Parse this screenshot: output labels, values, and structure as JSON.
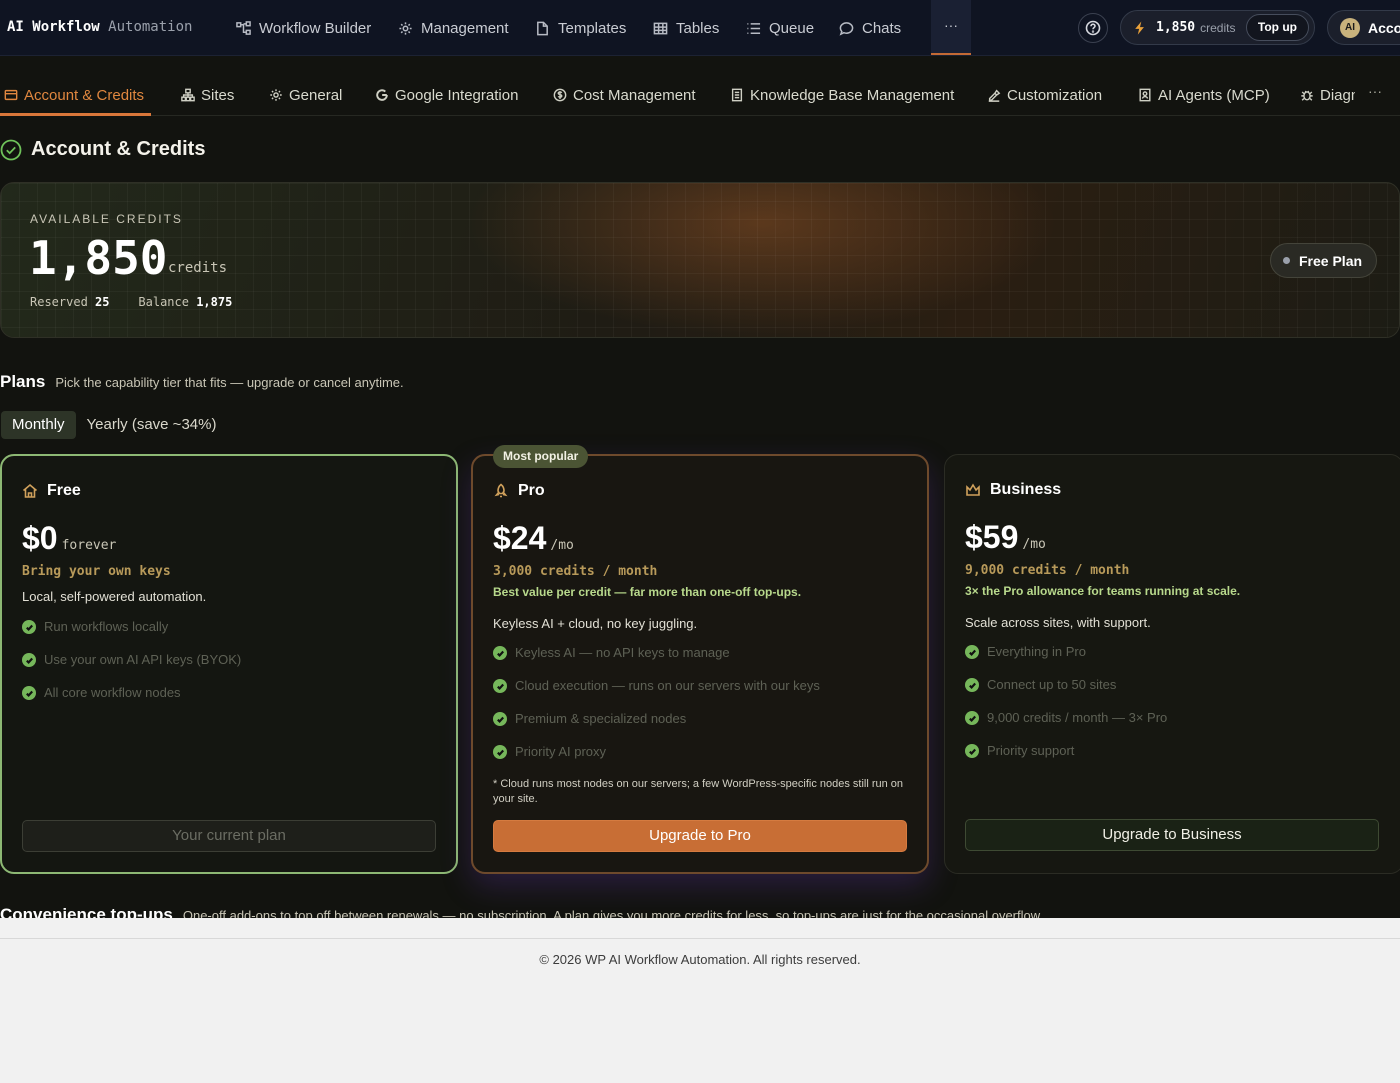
{
  "brand": {
    "bold": "AI Workflow",
    "light": "Automation"
  },
  "nav": {
    "items": [
      {
        "label": "Workflow Builder",
        "icon": "workflow-icon"
      },
      {
        "label": "Management",
        "icon": "gear-icon"
      },
      {
        "label": "Templates",
        "icon": "file-icon"
      },
      {
        "label": "Tables",
        "icon": "table-icon"
      },
      {
        "label": "Queue",
        "icon": "list-icon"
      },
      {
        "label": "Chats",
        "icon": "chat-icon"
      }
    ],
    "more_label": "···",
    "credits": {
      "value": "1,850",
      "label": "credits"
    },
    "topup_label": "Top up",
    "account": {
      "avatar": "AI",
      "label": "Account"
    }
  },
  "subnav": {
    "items": [
      {
        "label": "Account & Credits",
        "icon": "card-icon",
        "active": true
      },
      {
        "label": "Sites",
        "icon": "sitemap-icon"
      },
      {
        "label": "General",
        "icon": "gear-icon"
      },
      {
        "label": "Google Integration",
        "icon": "google-icon"
      },
      {
        "label": "Cost Management",
        "icon": "dollar-icon"
      },
      {
        "label": "Knowledge Base Management",
        "icon": "book-icon"
      },
      {
        "label": "Customization",
        "icon": "brush-icon"
      },
      {
        "label": "AI Agents (MCP)",
        "icon": "agent-icon"
      },
      {
        "label": "Diagnostics",
        "icon": "bug-icon"
      }
    ],
    "more_label": "···"
  },
  "section": {
    "title": "Account & Credits"
  },
  "credits_card": {
    "label": "AVAILABLE CREDITS",
    "value": "1,850",
    "unit": "credits",
    "reserved_label": "Reserved",
    "reserved_value": "25",
    "balance_label": "Balance",
    "balance_value": "1,875",
    "plan_badge": "Free Plan"
  },
  "plans": {
    "title": "Plans",
    "subtitle": "Pick the capability tier that fits — upgrade or cancel anytime.",
    "toggle": {
      "monthly": "Monthly",
      "yearly": "Yearly (save ~34%)"
    },
    "popular_badge": "Most popular",
    "free": {
      "name": "Free",
      "price": "$0",
      "unit": "forever",
      "credits": "Bring your own keys",
      "desc": "Local, self-powered automation.",
      "features": [
        "Run workflows locally",
        "Use your own AI API keys (BYOK)",
        "All core workflow nodes"
      ],
      "button": "Your current plan"
    },
    "pro": {
      "name": "Pro",
      "price": "$24",
      "unit": "/mo",
      "credits": "3,000 credits / month",
      "note": "Best value per credit — far more than one-off top-ups.",
      "desc": "Keyless AI + cloud, no key juggling.",
      "features": [
        "Keyless AI — no API keys to manage",
        "Cloud execution — runs on our servers with our keys",
        "Premium & specialized nodes",
        "Priority AI proxy"
      ],
      "footnote": "* Cloud runs most nodes on our servers; a few WordPress-specific nodes still run on your site.",
      "button": "Upgrade to Pro"
    },
    "business": {
      "name": "Business",
      "price": "$59",
      "unit": "/mo",
      "credits": "9,000 credits / month",
      "note": "3× the Pro allowance for teams running at scale.",
      "desc": "Scale across sites, with support.",
      "features": [
        "Everything in Pro",
        "Connect up to 50 sites",
        "9,000 credits / month — 3× Pro",
        "Priority support"
      ],
      "button": "Upgrade to Business"
    }
  },
  "topups": {
    "title": "Convenience top-ups",
    "subtitle": "One-off add-ons to top off between renewals — no subscription. A plan gives you more credits for less, so top-ups are just for the occasional overflow."
  },
  "footer": {
    "text": "© 2026 WP AI Workflow Automation. All rights reserved."
  },
  "colors": {
    "accent": "#d9773a",
    "success": "#76b75b",
    "nav_bg": "#0f1422",
    "page_bg": "#12130f"
  }
}
